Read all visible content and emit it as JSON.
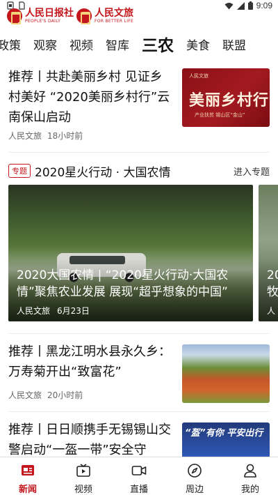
{
  "status_bar": {
    "time": "9:09",
    "icons": [
      "notification-icon",
      "sim-icon",
      "wifi-icon",
      "signal-icon",
      "battery-icon"
    ]
  },
  "header": {
    "logo_left": {
      "cn": "人民日报社",
      "en": "PEOPLE'S DAILY"
    },
    "logo_right": {
      "cn": "人民文旅",
      "en": "FOR BETTER LIFE"
    }
  },
  "tabs": [
    {
      "label": "政策"
    },
    {
      "label": "观察"
    },
    {
      "label": "视频"
    },
    {
      "label": "智库"
    },
    {
      "label": "三农",
      "active": true
    },
    {
      "label": "美食"
    },
    {
      "label": "联盟"
    }
  ],
  "items": [
    {
      "title": "推荐丨共赴美丽乡村 见证乡村美好 “2020美丽乡村行”云南保山启动",
      "source": "人民文旅",
      "time": "18小时前",
      "thumb": {
        "top": "人民文旅",
        "big": "美丽乡村行",
        "small": "产业扶贫 锡山区“金山”"
      }
    },
    {
      "title": "推荐丨黑龙江明水县永久乡：万寿菊开出“致富花”",
      "source": "人民文旅",
      "time": "20小时前"
    },
    {
      "title": "推荐丨日日顺携手无锡锡山交警启动“一盔一带”安全守",
      "thumb": {
        "banner": "“盔”有你 平安出行"
      }
    }
  ],
  "topic": {
    "badge": "专题",
    "title": "2020星火行动 · 大国农情",
    "more": "进入专题",
    "cards": [
      {
        "title": "2020大国农情 | “2020星火行动·大国农情”聚焦农业发展 展现“超乎想象的中国”",
        "source": "人民文旅",
        "date": "6月23日"
      },
      {
        "title": "20\n牧",
        "source": "人"
      }
    ]
  },
  "bottom_nav": [
    {
      "label": "新闻",
      "icon": "news-icon",
      "active": true
    },
    {
      "label": "视频",
      "icon": "video-icon"
    },
    {
      "label": "直播",
      "icon": "live-icon"
    },
    {
      "label": "周边",
      "icon": "compass-icon"
    },
    {
      "label": "我的",
      "icon": "profile-icon"
    }
  ],
  "colors": {
    "brand_red": "#c4161c",
    "text": "#111111",
    "meta": "#666666"
  }
}
